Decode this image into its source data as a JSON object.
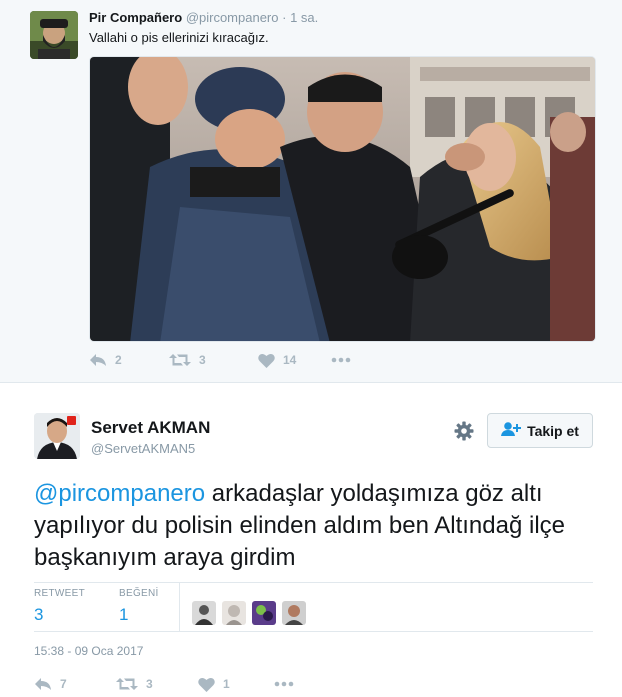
{
  "quoted_tweet": {
    "author_name": "Pir Compañero",
    "handle": "@pircompanero",
    "separator": "·",
    "time": "1 sa.",
    "text": "Vallahi o pis ellerinizi kıracağız.",
    "actions": {
      "reply_icon": "reply-icon",
      "reply_count": "2",
      "retweet_icon": "retweet-icon",
      "retweet_count": "3",
      "like_icon": "heart-icon",
      "like_count": "14",
      "more_icon": "more-icon"
    }
  },
  "main_tweet": {
    "author_name": "Servet AKMAN",
    "handle": "@ServetAKMAN5",
    "follow_label": "Takip et",
    "mention": "@pircompanero",
    "body": " arkadaşlar yoldaşımıza göz altı yapılıyor du polisin elinden aldım ben Altındağ ilçe başkanıyım araya girdim",
    "stats": {
      "retweet_label": "RETWEET",
      "retweet_value": "3",
      "like_label": "BEĞENİ",
      "like_value": "1"
    },
    "timestamp": "15:38 - 09 Oca 2017",
    "actions": {
      "reply_count": "7",
      "retweet_count": "3",
      "like_count": "1"
    }
  },
  "colors": {
    "link": "#1b95e0",
    "muted": "#8899a6",
    "icon": "#aab8c2",
    "background_top": "#f5f8fa"
  }
}
